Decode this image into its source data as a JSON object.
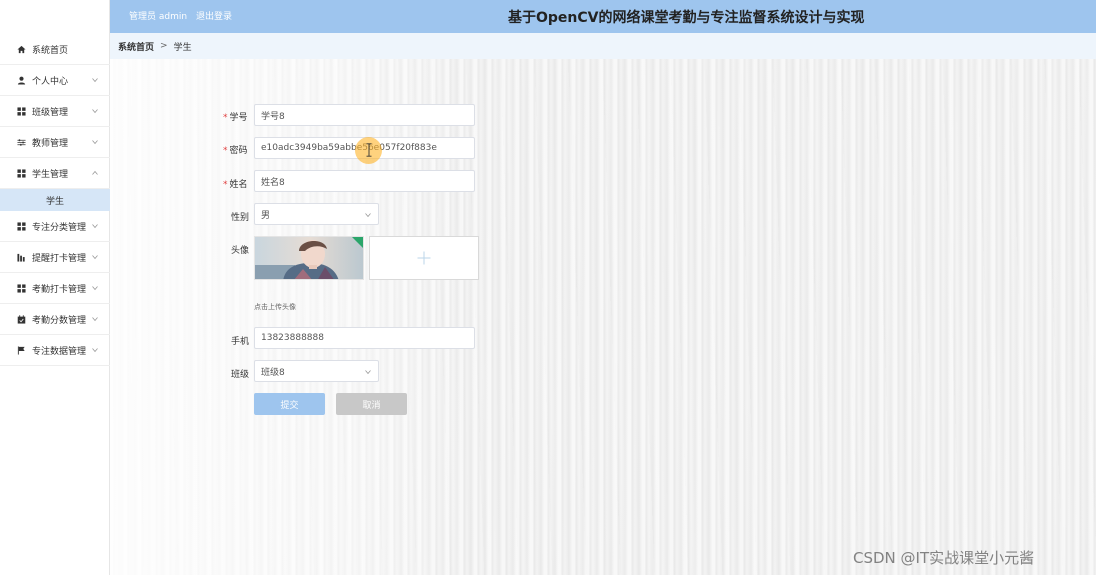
{
  "header": {
    "user_label": "管理员 admin",
    "logout_label": "退出登录",
    "system_title": "基于OpenCV的网络课堂考勤与专注监督系统设计与实现",
    "bg_color": "#9ec5ee"
  },
  "breadcrumb": {
    "home": "系统首页",
    "separator": ">",
    "current": "学生"
  },
  "sidebar": {
    "items": [
      {
        "label": "系统首页",
        "icon": "home-icon"
      },
      {
        "label": "个人中心",
        "icon": "person-icon"
      },
      {
        "label": "班级管理",
        "icon": "grid-icon"
      },
      {
        "label": "教师管理",
        "icon": "sliders-icon"
      },
      {
        "label": "学生管理",
        "icon": "grid-icon"
      },
      {
        "label": "专注分类管理",
        "icon": "grid-icon"
      },
      {
        "label": "提醒打卡管理",
        "icon": "chart-icon"
      },
      {
        "label": "考勤打卡管理",
        "icon": "grid-icon"
      },
      {
        "label": "考勤分数管理",
        "icon": "calendar-icon"
      },
      {
        "label": "专注数据管理",
        "icon": "flag-icon"
      }
    ],
    "active_sub": "学生",
    "active_sub_color": "#d6e6f7"
  },
  "form": {
    "student_id": {
      "label": "学号",
      "value": "学号8"
    },
    "password": {
      "label": "密码",
      "value": "e10adc3949ba59abbe56e057f20f883e"
    },
    "name": {
      "label": "姓名",
      "value": "姓名8"
    },
    "gender": {
      "label": "性别",
      "value": "男"
    },
    "avatar": {
      "label": "头像",
      "hint": "点击上传头像"
    },
    "phone": {
      "label": "手机",
      "value": "13823888888"
    },
    "class": {
      "label": "班级",
      "value": "班级8"
    },
    "submit_label": "提交",
    "cancel_label": "取消",
    "submit_color": "#9ec5ee",
    "cancel_color": "#c8c8c8"
  },
  "watermark": "CSDN @IT实战课堂小元酱"
}
